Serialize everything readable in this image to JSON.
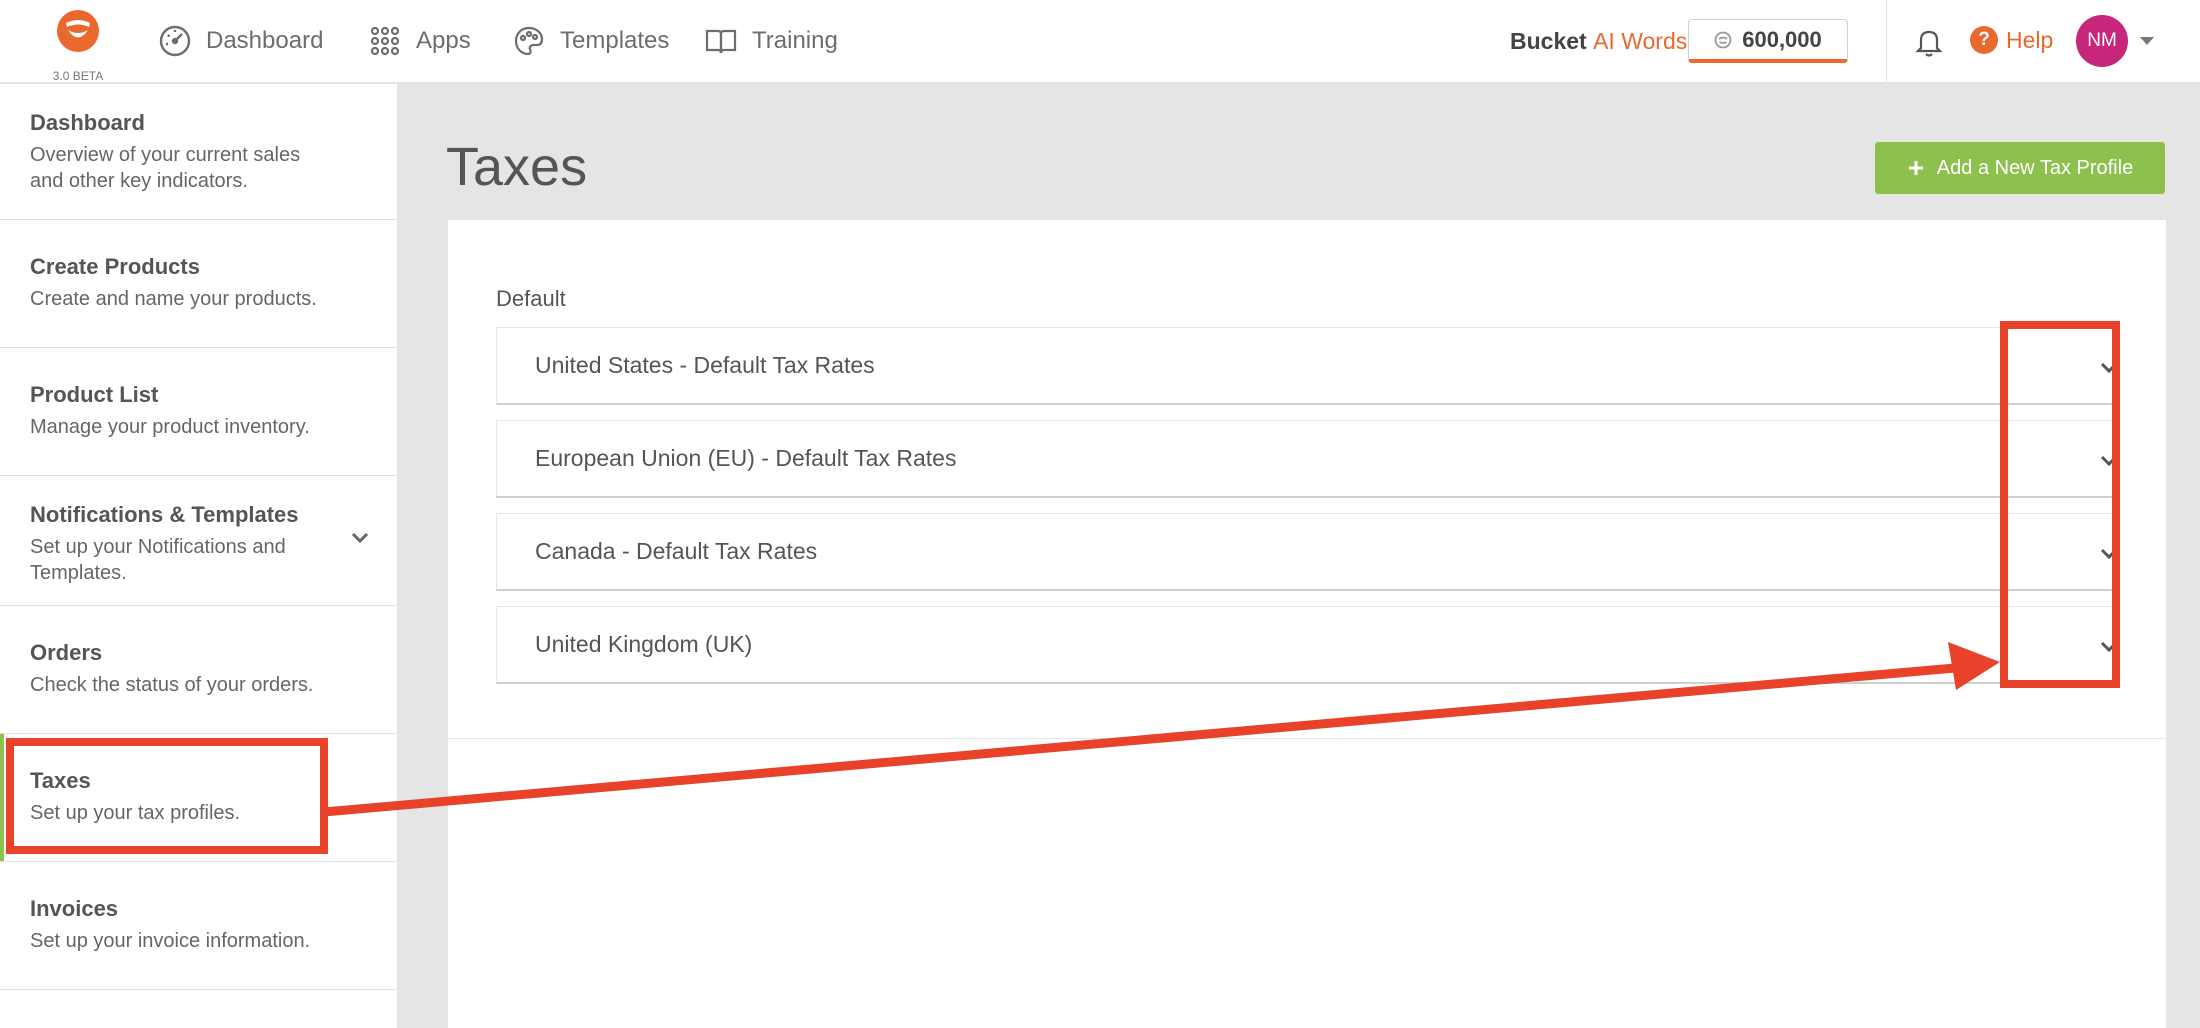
{
  "header": {
    "logo_badge": "3.0 BETA",
    "nav": [
      {
        "label": "Dashboard",
        "icon": "gauge-icon"
      },
      {
        "label": "Apps",
        "icon": "grid-icon"
      },
      {
        "label": "Templates",
        "icon": "palette-icon"
      },
      {
        "label": "Training",
        "icon": "book-icon"
      }
    ],
    "bucket_label": "Bucket",
    "bucket_accent": "AI Words",
    "word_count": "600,000",
    "help_label": "Help",
    "avatar_initials": "NM"
  },
  "sidebar": {
    "items": [
      {
        "title": "Dashboard",
        "desc": "Overview of your current sales and other key indicators."
      },
      {
        "title": "Create Products",
        "desc": "Create and name your products."
      },
      {
        "title": "Product List",
        "desc": "Manage your product inventory."
      },
      {
        "title": "Notifications & Templates",
        "desc": "Set up your Notifications and Templates."
      },
      {
        "title": "Orders",
        "desc": "Check the status of your orders."
      },
      {
        "title": "Taxes",
        "desc": "Set up your tax profiles."
      },
      {
        "title": "Invoices",
        "desc": "Set up your invoice information."
      }
    ],
    "active": "Taxes"
  },
  "main": {
    "title": "Taxes",
    "add_button_label": "Add a New Tax Profile",
    "section_label": "Default",
    "profiles": [
      {
        "label": "United States - Default Tax Rates"
      },
      {
        "label": "European Union (EU) - Default Tax Rates"
      },
      {
        "label": "Canada - Default Tax Rates"
      },
      {
        "label": "United Kingdom (UK)"
      }
    ]
  },
  "colors": {
    "brand_orange": "#e8682e",
    "accent_green": "#8dc04d",
    "avatar": "#c7267a",
    "annotation_red": "#e8432a"
  }
}
